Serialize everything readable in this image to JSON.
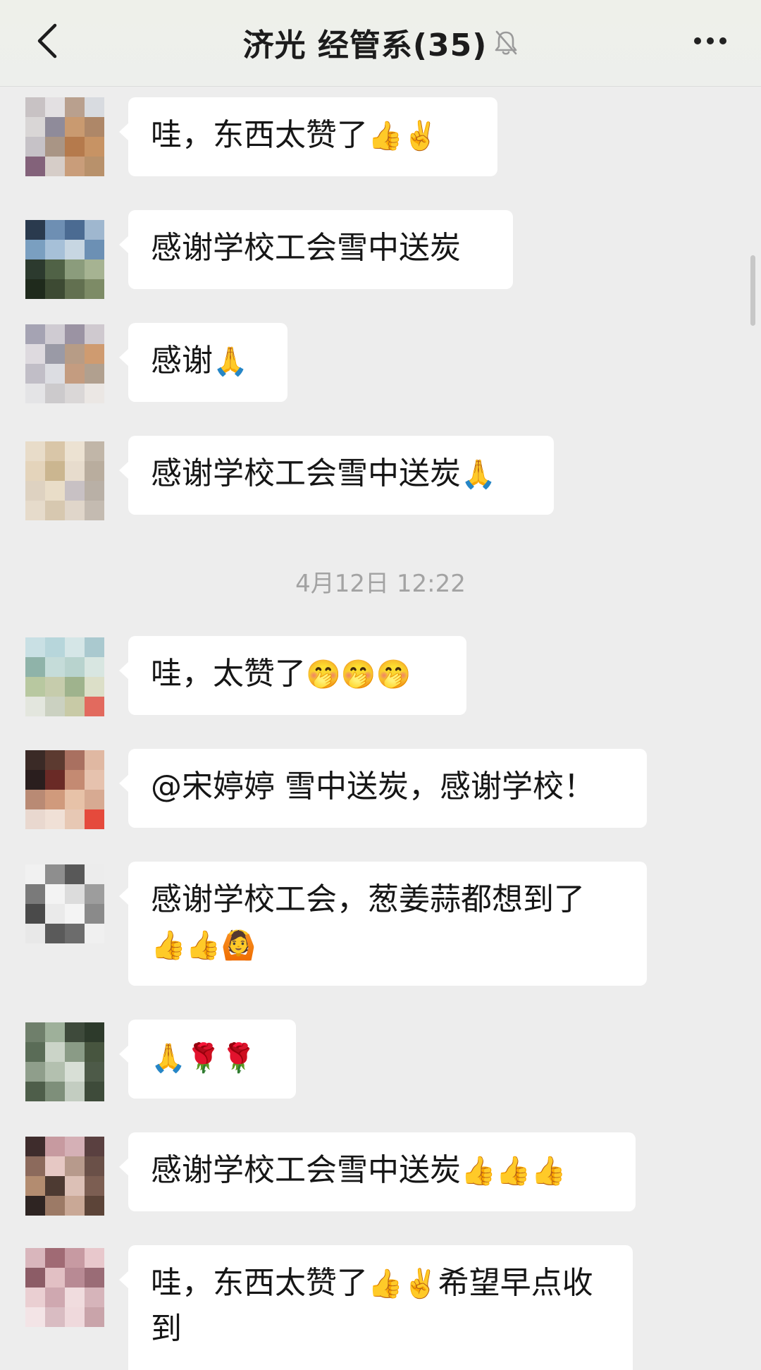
{
  "header": {
    "title": "济光 经管系(35)",
    "back_icon": "chevron-left-icon",
    "mute_icon": "bell-off-icon",
    "more_icon": "ellipsis-icon"
  },
  "timestamp": "4月12日 12:22",
  "messages": [
    {
      "text": "哇，东西太赞了",
      "emoji": "👍✌️"
    },
    {
      "text": "感谢学校工会雪中送炭",
      "emoji": ""
    },
    {
      "text": "感谢",
      "emoji": "🙏"
    },
    {
      "text": "感谢学校工会雪中送炭",
      "emoji": "🙏"
    },
    {
      "text": "哇，太赞了",
      "emoji": "🤭🤭🤭"
    },
    {
      "text": "@宋婷婷 雪中送炭，感谢学校！",
      "emoji": ""
    },
    {
      "text": "感谢学校工会，葱姜蒜都想到了",
      "emoji": "👍👍🙆"
    },
    {
      "text": "",
      "emoji": "🙏🌹🌹"
    },
    {
      "text": "感谢学校工会雪中送炭",
      "emoji": "👍👍👍"
    },
    {
      "text": "哇，东西太赞了",
      "emoji": "👍✌️",
      "text2": "希望早点收到"
    }
  ],
  "colors": {
    "background": "#ededed",
    "bubble": "#ffffff",
    "text": "#161616",
    "timestamp": "#a3a3a3"
  }
}
